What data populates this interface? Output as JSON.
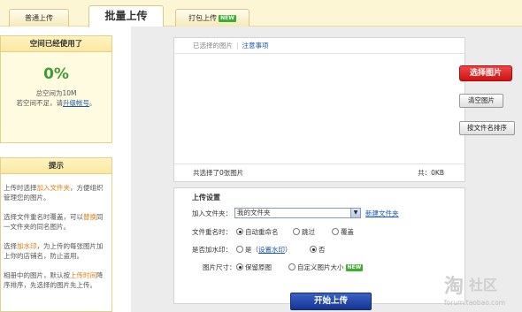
{
  "tabs": [
    {
      "label": "普通上传",
      "active": false,
      "badge": ""
    },
    {
      "label": "批量上传",
      "active": true,
      "badge": ""
    },
    {
      "label": "打包上传",
      "active": false,
      "badge": "NEW"
    }
  ],
  "space_panel": {
    "title": "空间已经使用了",
    "percent": "0%",
    "total_label": "总空间为10M",
    "shortage_prefix": "若空间不足，请",
    "upgrade_link": "升级帐号",
    "shortage_suffix": "。"
  },
  "tips_panel": {
    "title": "提示",
    "tips": [
      {
        "p1": "上传时选择",
        "hl": "加入文件夹",
        "p2": "，方便组织管理您的图片。"
      },
      {
        "p1": "选择文件重名时覆盖，可以",
        "hl": "替换",
        "p2": "同一文件夹的同名图片。"
      },
      {
        "p1": "选择",
        "hl": "加水印",
        "p2": "，为上传的每张图片加上你的店铺名，防止盗用。"
      },
      {
        "p1": "相册中的图片，默认按",
        "hl": "上传时间",
        "p2": "降序排序，先选择的图片先上传。"
      }
    ]
  },
  "file_box": {
    "header_label": "已选择的图片",
    "notice_link": "注意事项",
    "footer_count": "共选择了0张图片",
    "footer_size": "共：0KB"
  },
  "side_buttons": {
    "select": "选择图片",
    "clear": "清空图片",
    "sort": "按文件名排序"
  },
  "settings": {
    "title": "上传设置",
    "folder_label": "加入文件夹：",
    "folder_value": "我的文件夹",
    "new_folder_link": "新建文件夹",
    "rename_label": "文件重名时：",
    "rename_options": [
      "自动重命名",
      "跳过",
      "覆盖"
    ],
    "rename_selected": 0,
    "watermark_label": "是否加水印：",
    "watermark_yes": "是（",
    "watermark_link": "设置水印",
    "watermark_yes_close": "）",
    "watermark_no": "否",
    "watermark_selected": "no",
    "size_label": "图片尺寸：",
    "size_options": [
      "保留原图",
      "自定义图片大小"
    ],
    "size_badge": "NEW",
    "size_selected": 0
  },
  "start_button": "开始上传",
  "watermark_brand": {
    "glyph": "淘",
    "text": "社区",
    "url": "forum.taobao.com"
  },
  "colors": {
    "accent_red": "#d91c1c",
    "accent_blue": "#1a57b5",
    "highlight_orange": "#e57b0f",
    "highlight_green": "#3f9c34",
    "panel_bg": "#fffbe0"
  }
}
